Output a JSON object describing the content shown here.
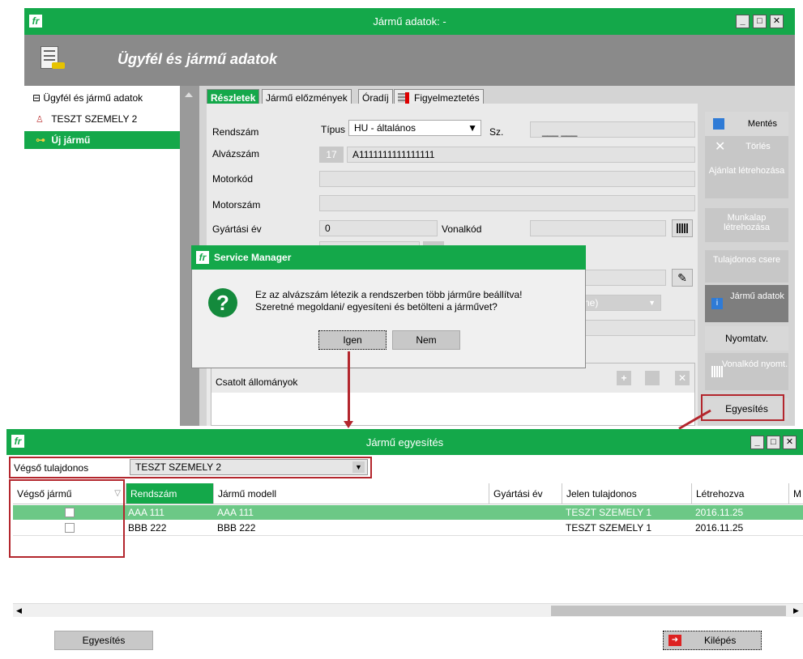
{
  "back_window": {
    "title": "Jármű adatok: -",
    "header_title": "Ügyfél és jármű adatok",
    "tree": [
      {
        "label": "Ügyfél és jármű adatok",
        "prefix": "⊟"
      },
      {
        "label": "TESZT SZEMELY 2",
        "prefix": "👤"
      },
      {
        "label": "Új jármű",
        "prefix": "🚗"
      }
    ],
    "tabs": [
      "Részletek",
      "Jármű előzmények",
      "Óradíj",
      "Figyelmeztetés"
    ],
    "form": {
      "rendszam_label": "Rendszám",
      "tipus_label": "Típus",
      "tipus_value": "HU - általános",
      "sz_label": "Sz.",
      "rendszam_mask": "___ ___",
      "alvazszam_label": "Alvázszám",
      "alvazszam_count": "17",
      "alvazszam_value": "A1111111111111111",
      "motorkod_label": "Motorkód",
      "motorszam_label": "Motorszám",
      "gyartasi_ev_label": "Gyártási év",
      "gyartasi_ev_value": "0",
      "vonalkod_label": "Vonalkód",
      "partial_dropdown": "ne)",
      "csatolt_label": "Csatolt állományok"
    },
    "side_buttons": [
      {
        "label": "Mentés"
      },
      {
        "label": "Törlés"
      },
      {
        "label": "Ajánlat létrehozása"
      },
      {
        "label": "Munkalap létrehozása"
      },
      {
        "label": "Tulajdonos csere"
      },
      {
        "label": "Jármű adatok"
      },
      {
        "label": "Nyomtatv."
      },
      {
        "label": "Vonalkód nyomt."
      },
      {
        "label": "Egyesítés"
      }
    ]
  },
  "dialog": {
    "title": "Service Manager",
    "message_line1": "Ez az alvázszám létezik a rendszerben több járműre beállítva!",
    "message_line2": "Szeretné megoldani/ egyesíteni és betölteni a járművet?",
    "yes_label": "Igen",
    "no_label": "Nem"
  },
  "merge_window": {
    "title": "Jármű egyesítés",
    "owner_label": "Végső tulajdonos",
    "owner_value": "TESZT SZEMELY 2",
    "columns": [
      "Végső jármű",
      "Rendszám",
      "Jármű modell",
      "Gyártási év",
      "Jelen tulajdonos",
      "Létrehozva",
      "M"
    ],
    "rows": [
      {
        "rendszam": "AAA 111",
        "modell": "AAA 111",
        "ev": "",
        "tulajdonos": "TESZT SZEMELY 1",
        "letrehozva": "2016.11.25",
        "selected": true
      },
      {
        "rendszam": "BBB 222",
        "modell": "BBB 222",
        "ev": "",
        "tulajdonos": "TESZT SZEMELY 1",
        "letrehozva": "2016.11.25",
        "selected": false
      }
    ],
    "merge_button": "Egyesítés",
    "exit_button": "Kilépés"
  },
  "colors": {
    "accent": "#14a84a",
    "highlight": "#b3262d"
  }
}
